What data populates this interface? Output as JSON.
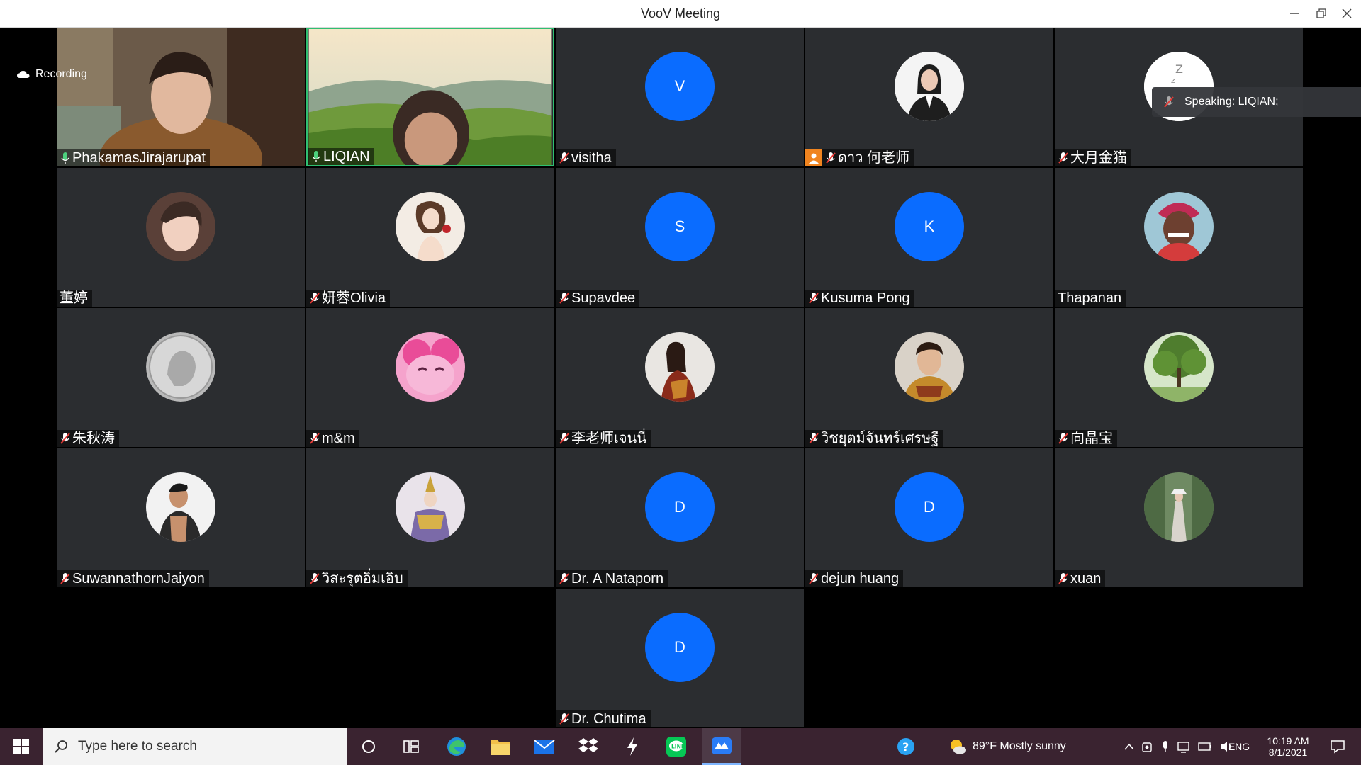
{
  "window": {
    "title": "VooV Meeting"
  },
  "recording": {
    "label": "Recording"
  },
  "speaking": {
    "label": "Speaking: LIQIAN;"
  },
  "participants": [
    {
      "name": "PhakamasJirajarupat",
      "muted": false
    },
    {
      "name": "LIQIAN",
      "muted": false
    },
    {
      "name": "visitha",
      "muted": true,
      "initial": "V"
    },
    {
      "name": "ดาว 何老师",
      "muted": true
    },
    {
      "name": "大月金猫",
      "muted": true
    },
    {
      "name": "董婷",
      "muted": false
    },
    {
      "name": "妍蓉Olivia",
      "muted": true
    },
    {
      "name": "Supavdee",
      "muted": true,
      "initial": "S"
    },
    {
      "name": "Kusuma Pong",
      "muted": true,
      "initial": "K"
    },
    {
      "name": "Thapanan",
      "muted": false
    },
    {
      "name": "朱秋涛",
      "muted": true
    },
    {
      "name": "m&m",
      "muted": true
    },
    {
      "name": "李老师เจนนี่",
      "muted": true
    },
    {
      "name": "วิชยุตม์จันทร์เศรษฐี",
      "muted": true
    },
    {
      "name": "向晶宝",
      "muted": true
    },
    {
      "name": "SuwannathornJaiyon",
      "muted": true
    },
    {
      "name": "วิสะรุตอิ่มเอิบ",
      "muted": true
    },
    {
      "name": "Dr. A Nataporn",
      "muted": true,
      "initial": "D"
    },
    {
      "name": "dejun huang",
      "muted": true,
      "initial": "D"
    },
    {
      "name": "xuan",
      "muted": true
    },
    {
      "name": "Dr. Chutima",
      "muted": true,
      "initial": "D"
    }
  ],
  "taskbar": {
    "search_placeholder": "Type here to search",
    "weather": "89°F  Mostly sunny",
    "language": "ENG",
    "time": "10:19 AM",
    "date": "8/1/2021"
  },
  "colors": {
    "tile_bg": "#2b2d30",
    "avatar_blue": "#0a6cff",
    "active_border": "#2fbf71",
    "taskbar_bg": "#3a2330"
  }
}
